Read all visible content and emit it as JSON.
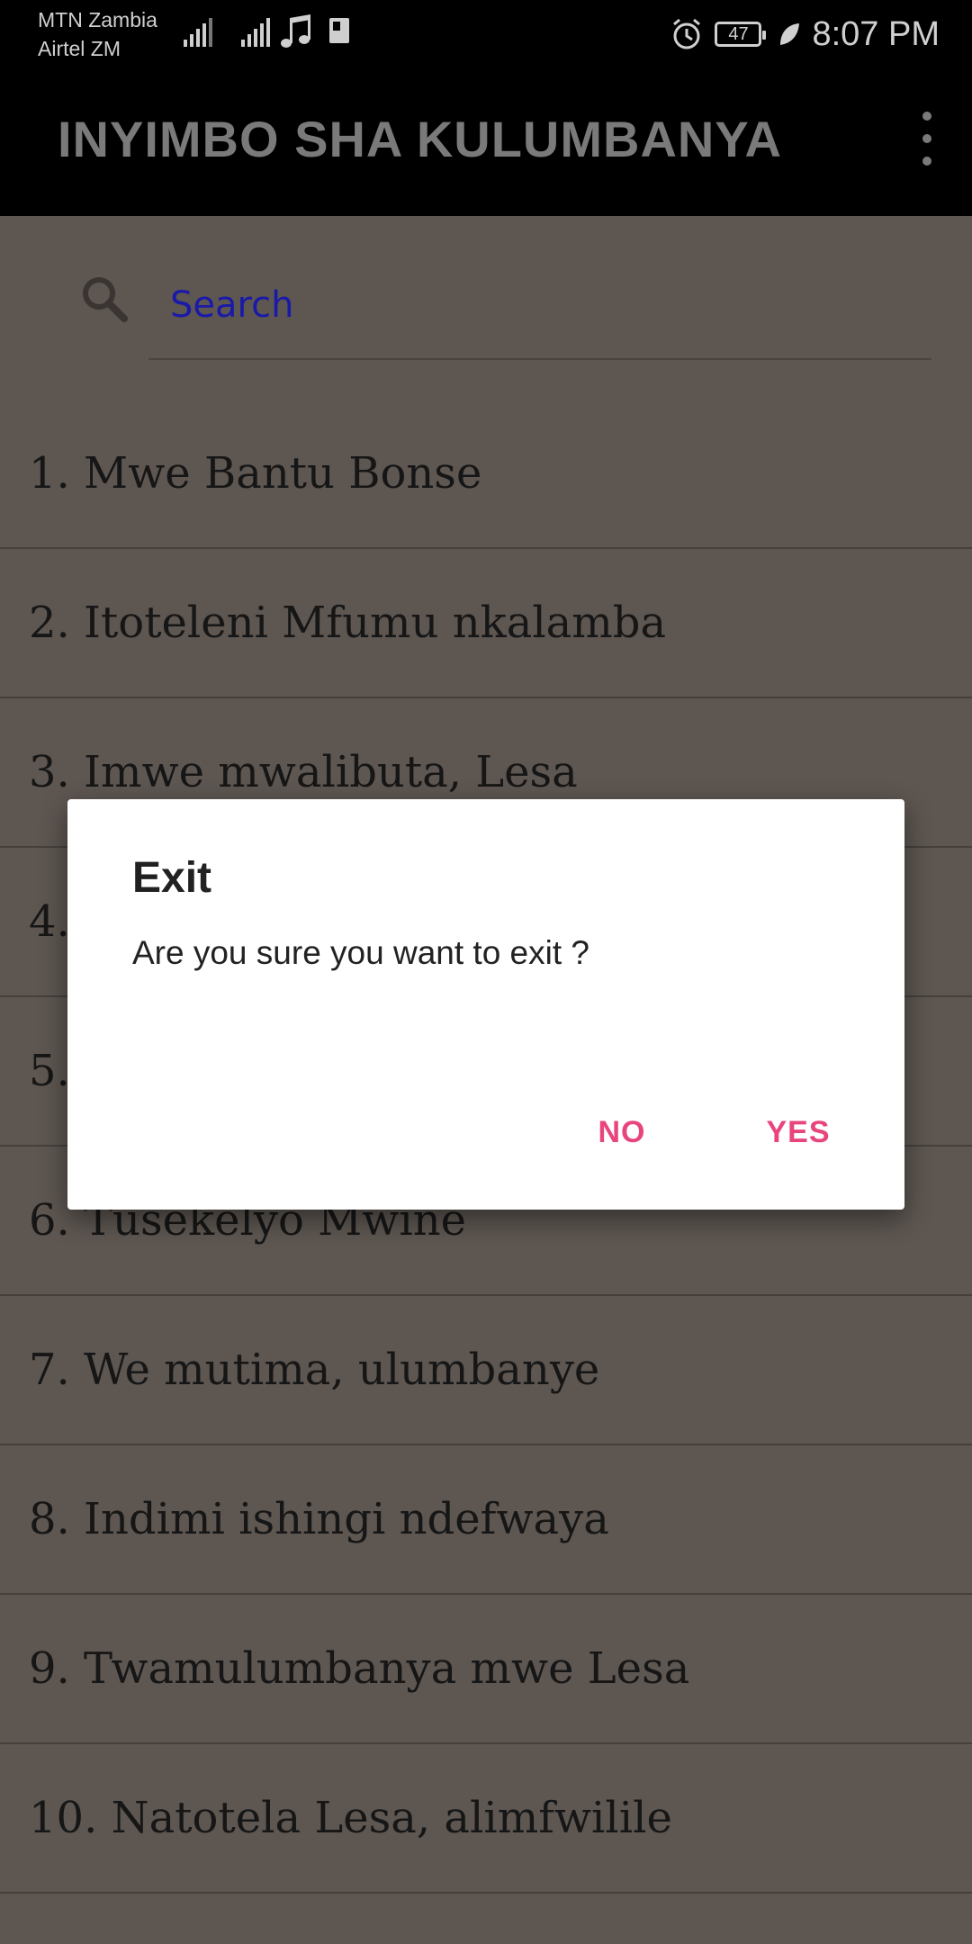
{
  "status_bar": {
    "carrier_1": "MTN Zambia",
    "carrier_2": "Airtel ZM",
    "battery": "47",
    "time": "8:07 PM"
  },
  "app_bar": {
    "title": "INYIMBO SHA KULUMBANYA",
    "overflow_icon": "more-vert-icon"
  },
  "search": {
    "placeholder": "Search",
    "icon": "search-icon"
  },
  "songs": [
    "1. Mwe Bantu Bonse",
    "2. Itoteleni Mfumu nkalamba",
    "3. Imwe mwalibuta, Lesa",
    "4. ",
    "5. ",
    "6. Tusekelyo Mwine",
    "7. We mutima, ulumbanye",
    "8. Indimi ishingi ndefwaya",
    "9. Twamulumbanya mwe Lesa",
    "10. Natotela Lesa, alimfwilile"
  ],
  "dialog": {
    "title": "Exit",
    "message": "Are you sure you want to exit ?",
    "no_label": "NO",
    "yes_label": "YES",
    "accent_color": "#e8457f"
  }
}
